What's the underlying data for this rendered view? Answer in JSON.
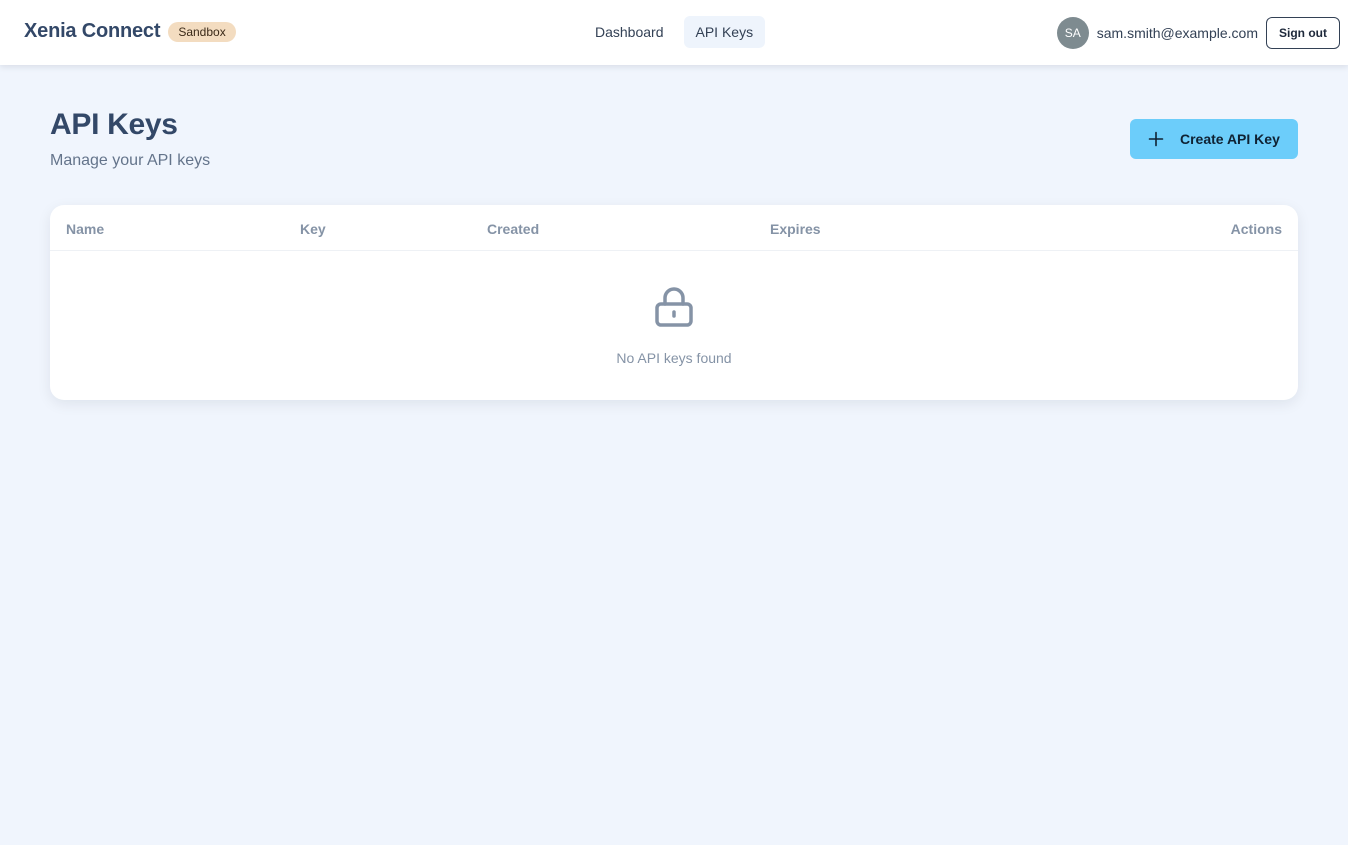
{
  "header": {
    "brand": "Xenia Connect",
    "environment_badge": "Sandbox",
    "nav": [
      {
        "label": "Dashboard",
        "active": false
      },
      {
        "label": "API Keys",
        "active": true
      }
    ],
    "user": {
      "initials": "SA",
      "email": "sam.smith@example.com"
    },
    "sign_out_label": "Sign out"
  },
  "page": {
    "title": "API Keys",
    "subtitle": "Manage your API keys",
    "create_button_label": "Create API Key"
  },
  "table": {
    "columns": [
      "Name",
      "Key",
      "Created",
      "Expires",
      "Actions"
    ],
    "rows": [],
    "empty_message": "No API keys found"
  },
  "icons": {
    "create_button": "plus-icon",
    "empty_state": "lock-icon"
  },
  "colors": {
    "page_background": "#f0f5fd",
    "primary_button": "#6ccdfa",
    "badge": "#f3dcc0",
    "avatar": "#7e8b90",
    "muted_text": "#8593a6"
  }
}
